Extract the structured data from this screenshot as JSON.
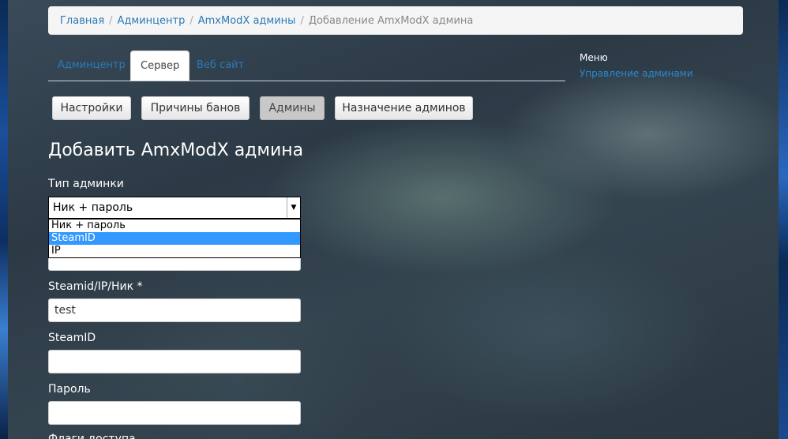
{
  "breadcrumb": {
    "home": "Главная",
    "admincenter": "Админцентр",
    "amx_admins": "AmxModX админы",
    "current": "Добавление AmxModX админа",
    "sep": "/"
  },
  "tabs": {
    "admincenter": "Админцентр",
    "server": "Сервер",
    "website": "Веб сайт"
  },
  "menu": {
    "title": "Меню",
    "link": "Управление админами"
  },
  "buttons": {
    "settings": "Настройки",
    "ban_reasons": "Причины банов",
    "admins": "Админы",
    "assign_admins": "Назначение админов"
  },
  "form": {
    "title": "Добавить AmxModX админа",
    "type_label": "Тип админки",
    "type_value": "Ник + пароль",
    "type_options": [
      "Ник + пароль",
      "SteamID",
      "IP"
    ],
    "type_highlighted": "SteamID",
    "steamid_ip_nick_label": "Steamid/IP/Ник *",
    "steamid_ip_nick_value": "test",
    "steamid_label": "SteamID",
    "steamid_value": "",
    "password_label": "Пароль",
    "password_value": "",
    "access_flags_label": "Флаги доступа"
  },
  "colors": {
    "link": "#2a7ab8",
    "highlight": "#3399ff"
  }
}
